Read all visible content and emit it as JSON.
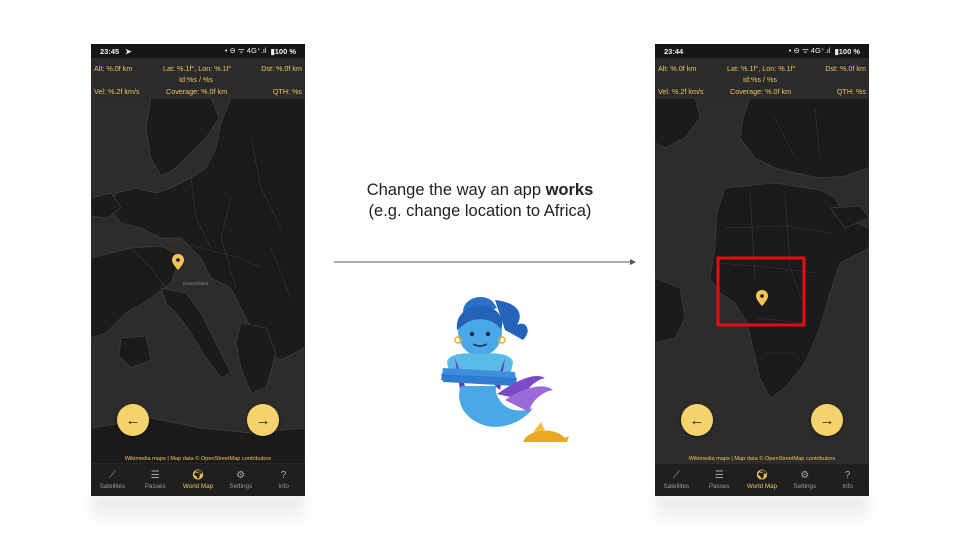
{
  "caption": {
    "line1_prefix": "Change the way an app ",
    "line1_bold": "works",
    "line2": "(e.g. change location to Africa)"
  },
  "left_phone": {
    "status": {
      "time": "23:45",
      "icons": "• ⊖ ᯤ 4G⁺.ıl",
      "battery": "▮100 %"
    },
    "info": {
      "alt": "Alt: %.0f km",
      "latlon": "Lat: %.1f°, Lon: %.1f°",
      "dst": "Dst: %.0f km",
      "id": "Id:%s / %s",
      "vel": "Vel: %.2f km/s",
      "coverage": "Coverage: %.0f km",
      "qth": "QTH: %s"
    },
    "map": {
      "region": "Europe",
      "marker_label": "Deutschland",
      "attribution": "Wikimedia maps | Map data © OpenStreetMap contributors"
    },
    "fab_prev": "←",
    "fab_next": "→",
    "nav": [
      {
        "label": "Satellites",
        "icon": "satellite-icon",
        "glyph": "⟋"
      },
      {
        "label": "Passes",
        "icon": "list-icon",
        "glyph": "☰"
      },
      {
        "label": "World Map",
        "icon": "globe-icon",
        "glyph": "🌍︎"
      },
      {
        "label": "Settings",
        "icon": "gear-icon",
        "glyph": "⚙"
      },
      {
        "label": "Info",
        "icon": "help-icon",
        "glyph": "?"
      }
    ],
    "active_tab": "World Map"
  },
  "right_phone": {
    "status": {
      "time": "23:44",
      "icons": "• ⊖ ᯤ 4G⁺.ıl",
      "battery": "▮100 %"
    },
    "info": {
      "alt": "Alt: %.0f km",
      "latlon": "Lat: %.1f°, Lon: %.1f°",
      "dst": "Dst: %.0f km",
      "id": "Id:%s / %s",
      "vel": "Vel: %.2f km/s",
      "coverage": "Coverage: %.0f km",
      "qth": "QTH: %s"
    },
    "map": {
      "region": "Africa",
      "attribution": "Wikimedia maps | Map data © OpenStreetMap contributors",
      "highlight_color": "#e01010"
    },
    "fab_prev": "←",
    "fab_next": "→",
    "nav": [
      {
        "label": "Satellites",
        "icon": "satellite-icon",
        "glyph": "⟋"
      },
      {
        "label": "Passes",
        "icon": "list-icon",
        "glyph": "☰"
      },
      {
        "label": "World Map",
        "icon": "globe-icon",
        "glyph": "🌍︎"
      },
      {
        "label": "Settings",
        "icon": "gear-icon",
        "glyph": "⚙"
      },
      {
        "label": "Info",
        "icon": "help-icon",
        "glyph": "?"
      }
    ],
    "active_tab": "World Map"
  },
  "colors": {
    "accent": "#f2c45a",
    "map_land": "#1b1b1b",
    "map_water": "#2c2c2c",
    "border": "#3e3e3e"
  }
}
